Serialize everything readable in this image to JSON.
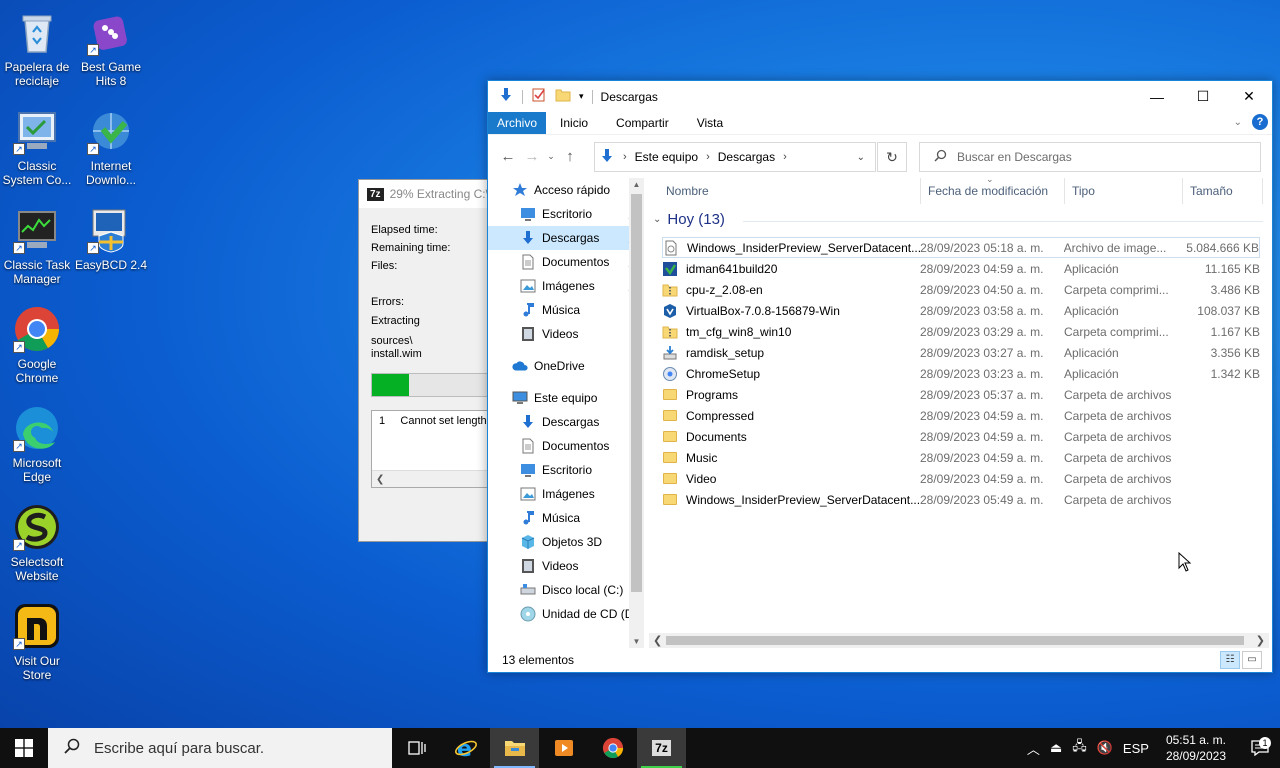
{
  "desktop": {
    "icons": [
      {
        "label": "Papelera de reciclaje",
        "icon": "recycle-bin-icon"
      },
      {
        "label": "Best Game Hits 8",
        "icon": "dice-icon"
      },
      {
        "label": "Classic System Co...",
        "icon": "control-panel-icon"
      },
      {
        "label": "Internet Downlo...",
        "icon": "idm-icon"
      },
      {
        "label": "Classic Task Manager",
        "icon": "task-manager-icon"
      },
      {
        "label": "EasyBCD 2.4",
        "icon": "easybcd-icon"
      },
      {
        "label": "Google Chrome",
        "icon": "chrome-icon"
      },
      {
        "label": "Microsoft Edge",
        "icon": "edge-icon"
      },
      {
        "label": "Selectsoft Website",
        "icon": "selectsoft-icon"
      },
      {
        "label": "Visit Our Store",
        "icon": "store-icon"
      }
    ]
  },
  "zip": {
    "badge": "7z",
    "title": "29% Extracting C:\\",
    "elapsed": "Elapsed time:",
    "remaining": "Remaining time:",
    "files": "Files:",
    "errors": "Errors:",
    "extracting": "Extracting",
    "path1": "sources\\",
    "path2": "install.wim",
    "progress": 0.29,
    "log_index": "1",
    "log_text": "Cannot set length"
  },
  "explorer": {
    "title": "Descargas",
    "tabs": [
      "Archivo",
      "Inicio",
      "Compartir",
      "Vista"
    ],
    "address": {
      "root": "Este equipo",
      "current": "Descargas"
    },
    "search_placeholder": "Buscar en Descargas",
    "nav": [
      {
        "label": "Acceso rápido",
        "icon": "star-icon",
        "indent": 0
      },
      {
        "label": "Escritorio",
        "icon": "desktop-icon",
        "indent": 1,
        "pin": true
      },
      {
        "label": "Descargas",
        "icon": "download-icon",
        "indent": 1,
        "pin": true,
        "selected": true
      },
      {
        "label": "Documentos",
        "icon": "documents-icon",
        "indent": 1,
        "pin": true
      },
      {
        "label": "Imágenes",
        "icon": "pictures-icon",
        "indent": 1,
        "pin": true
      },
      {
        "label": "Música",
        "icon": "music-icon",
        "indent": 1
      },
      {
        "label": "Videos",
        "icon": "videos-icon",
        "indent": 1
      },
      {
        "label": "",
        "icon": "",
        "indent": 0,
        "spacer": true
      },
      {
        "label": "OneDrive",
        "icon": "onedrive-icon",
        "indent": 0
      },
      {
        "label": "",
        "icon": "",
        "indent": 0,
        "spacer": true
      },
      {
        "label": "Este equipo",
        "icon": "computer-icon",
        "indent": 0
      },
      {
        "label": "Descargas",
        "icon": "download-icon",
        "indent": 1
      },
      {
        "label": "Documentos",
        "icon": "documents-icon",
        "indent": 1
      },
      {
        "label": "Escritorio",
        "icon": "desktop-icon",
        "indent": 1
      },
      {
        "label": "Imágenes",
        "icon": "pictures-icon",
        "indent": 1
      },
      {
        "label": "Música",
        "icon": "music-icon",
        "indent": 1
      },
      {
        "label": "Objetos 3D",
        "icon": "objects-3d-icon",
        "indent": 1
      },
      {
        "label": "Videos",
        "icon": "videos-icon",
        "indent": 1
      },
      {
        "label": "Disco local (C:)",
        "icon": "drive-icon",
        "indent": 1
      },
      {
        "label": "Unidad de CD (D",
        "icon": "cd-drive-icon",
        "indent": 1
      }
    ],
    "columns": [
      "Nombre",
      "Fecha de modificación",
      "Tipo",
      "Tamaño"
    ],
    "group": "Hoy (13)",
    "files": [
      {
        "name": "Windows_InsiderPreview_ServerDatacent...",
        "date": "28/09/2023 05:18 a. m.",
        "type": "Archivo de image...",
        "size": "5.084.666 KB",
        "icon": "disc-image-icon"
      },
      {
        "name": "idman641build20",
        "date": "28/09/2023 04:59 a. m.",
        "type": "Aplicación",
        "size": "11.165 KB",
        "icon": "idm-icon"
      },
      {
        "name": "cpu-z_2.08-en",
        "date": "28/09/2023 04:50 a. m.",
        "type": "Carpeta comprimi...",
        "size": "3.486 KB",
        "icon": "zip-folder-icon"
      },
      {
        "name": "VirtualBox-7.0.8-156879-Win",
        "date": "28/09/2023 03:58 a. m.",
        "type": "Aplicación",
        "size": "108.037 KB",
        "icon": "virtualbox-icon"
      },
      {
        "name": "tm_cfg_win8_win10",
        "date": "28/09/2023 03:29 a. m.",
        "type": "Carpeta comprimi...",
        "size": "1.167 KB",
        "icon": "zip-folder-icon"
      },
      {
        "name": "ramdisk_setup",
        "date": "28/09/2023 03:27 a. m.",
        "type": "Aplicación",
        "size": "3.356 KB",
        "icon": "installer-icon"
      },
      {
        "name": "ChromeSetup",
        "date": "28/09/2023 03:23 a. m.",
        "type": "Aplicación",
        "size": "1.342 KB",
        "icon": "setup-icon"
      },
      {
        "name": "Programs",
        "date": "28/09/2023 05:37 a. m.",
        "type": "Carpeta de archivos",
        "size": "",
        "icon": "folder-icon"
      },
      {
        "name": "Compressed",
        "date": "28/09/2023 04:59 a. m.",
        "type": "Carpeta de archivos",
        "size": "",
        "icon": "folder-icon"
      },
      {
        "name": "Documents",
        "date": "28/09/2023 04:59 a. m.",
        "type": "Carpeta de archivos",
        "size": "",
        "icon": "folder-icon"
      },
      {
        "name": "Music",
        "date": "28/09/2023 04:59 a. m.",
        "type": "Carpeta de archivos",
        "size": "",
        "icon": "folder-icon"
      },
      {
        "name": "Video",
        "date": "28/09/2023 04:59 a. m.",
        "type": "Carpeta de archivos",
        "size": "",
        "icon": "folder-icon"
      },
      {
        "name": "Windows_InsiderPreview_ServerDatacent...",
        "date": "28/09/2023 05:49 a. m.",
        "type": "Carpeta de archivos",
        "size": "",
        "icon": "folder-icon"
      }
    ],
    "status": "13 elementos"
  },
  "taskbar": {
    "search_placeholder": "Escribe aquí para buscar.",
    "apps": [
      "task-view-icon",
      "ie-icon",
      "file-explorer-icon",
      "media-player-icon",
      "chrome-icon",
      "7zip-icon"
    ],
    "lang": "ESP",
    "time": "05:51 a. m.",
    "date": "28/09/2023",
    "notifications": "1"
  },
  "colors": {
    "accent": "#1979ca",
    "selection": "#cce8ff",
    "progress": "#06b025"
  }
}
